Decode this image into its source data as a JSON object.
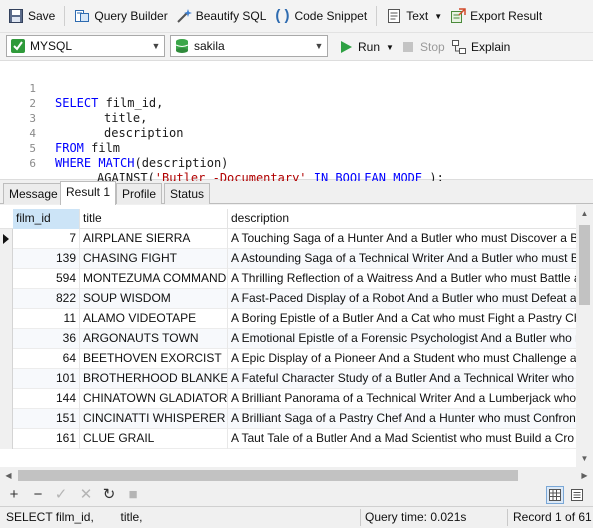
{
  "toolbar": {
    "save": "Save",
    "query_builder": "Query Builder",
    "beautify": "Beautify SQL",
    "code_snippet": "Code Snippet",
    "text": "Text",
    "export_result": "Export Result"
  },
  "connection": {
    "selected": "MYSQL"
  },
  "database": {
    "selected": "sakila"
  },
  "run": {
    "run": "Run",
    "stop": "Stop",
    "explain": "Explain"
  },
  "editor": {
    "lines": [
      {
        "num": "1"
      },
      {
        "num": "2"
      },
      {
        "num": "3"
      },
      {
        "num": "4"
      },
      {
        "num": "5"
      },
      {
        "num": "6"
      }
    ],
    "tokens": {
      "select": "SELECT",
      "film_id": " film_id,",
      "title": "title,",
      "description": "description",
      "from": "FROM",
      "film": " film",
      "where": "WHERE",
      "match": " MATCH",
      "match_arg": "(description)",
      "against": "AGAINST(",
      "search_str": "'Butler -Documentary'",
      "in": " IN",
      "boolean": " BOOLEAN MODE",
      "end": " );"
    }
  },
  "result_tabs": [
    "Message",
    "Result 1",
    "Profile",
    "Status"
  ],
  "grid": {
    "columns": [
      "film_id",
      "title",
      "description"
    ],
    "rows": [
      [
        "7",
        "AIRPLANE SIERRA",
        "A Touching Saga of a Hunter And a Butler who must Discover a B"
      ],
      [
        "139",
        "CHASING FIGHT",
        "A Astounding Saga of a Technical Writer And a Butler who must B"
      ],
      [
        "594",
        "MONTEZUMA COMMAND",
        "A Thrilling Reflection of a Waitress And a Butler who must Battle a"
      ],
      [
        "822",
        "SOUP WISDOM",
        "A Fast-Paced Display of a Robot And a Butler who must Defeat a I"
      ],
      [
        "11",
        "ALAMO VIDEOTAPE",
        "A Boring Epistle of a Butler And a Cat who must Fight a Pastry Ch"
      ],
      [
        "36",
        "ARGONAUTS TOWN",
        "A Emotional Epistle of a Forensic Psychologist And a Butler who n"
      ],
      [
        "64",
        "BEETHOVEN EXORCIST",
        "A Epic Display of a Pioneer And a Student who must Challenge a"
      ],
      [
        "101",
        "BROTHERHOOD BLANKET",
        "A Fateful Character Study of a Butler And a Technical Writer who"
      ],
      [
        "144",
        "CHINATOWN GLADIATOR",
        "A Brilliant Panorama of a Technical Writer And a Lumberjack who"
      ],
      [
        "151",
        "CINCINATTI WHISPERER",
        "A Brilliant Saga of a Pastry Chef And a Hunter who must Confront"
      ],
      [
        "161",
        "CLUE GRAIL",
        "A Taut Tale of a Butler And a Mad Scientist who must Build a Cro"
      ]
    ]
  },
  "status": {
    "sql": "SELECT film_id,        title,",
    "query_time": "Query time: 0.021s",
    "record": "Record 1 of 61"
  },
  "colors": {
    "keyword": "#0000ff",
    "string": "#b00000",
    "selected_header": "#cce4f7"
  }
}
